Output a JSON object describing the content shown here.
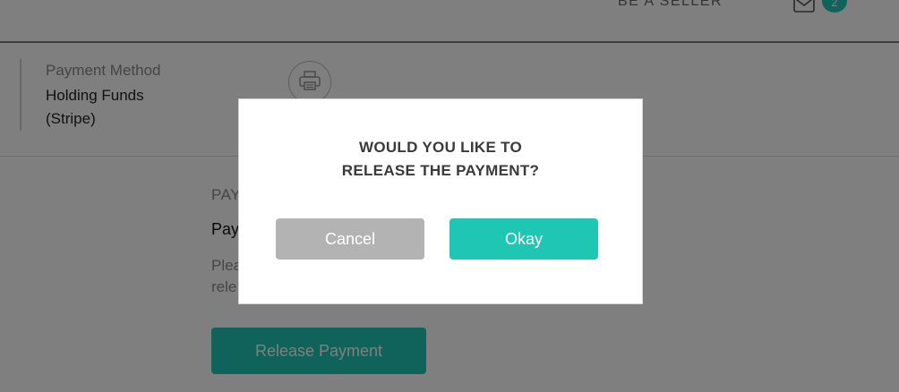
{
  "header": {
    "be_seller_label": "BE A SELLER",
    "notification_count": "2"
  },
  "order": {
    "payment_method_label": "Payment Method",
    "payment_method_value": "Holding Funds (Stripe)"
  },
  "payment_section": {
    "heading": "PAY",
    "subheading": "Pay",
    "description": "Plea rele",
    "release_button_label": "Release Payment"
  },
  "modal": {
    "title_line1": "WOULD YOU LIKE TO",
    "title_line2": "RELEASE THE PAYMENT?",
    "cancel_label": "Cancel",
    "okay_label": "Okay"
  },
  "colors": {
    "accent": "#1fc6b4",
    "cancel": "#b3b3b3"
  },
  "icons": {
    "mail": "mail-icon",
    "print": "printer-icon"
  }
}
